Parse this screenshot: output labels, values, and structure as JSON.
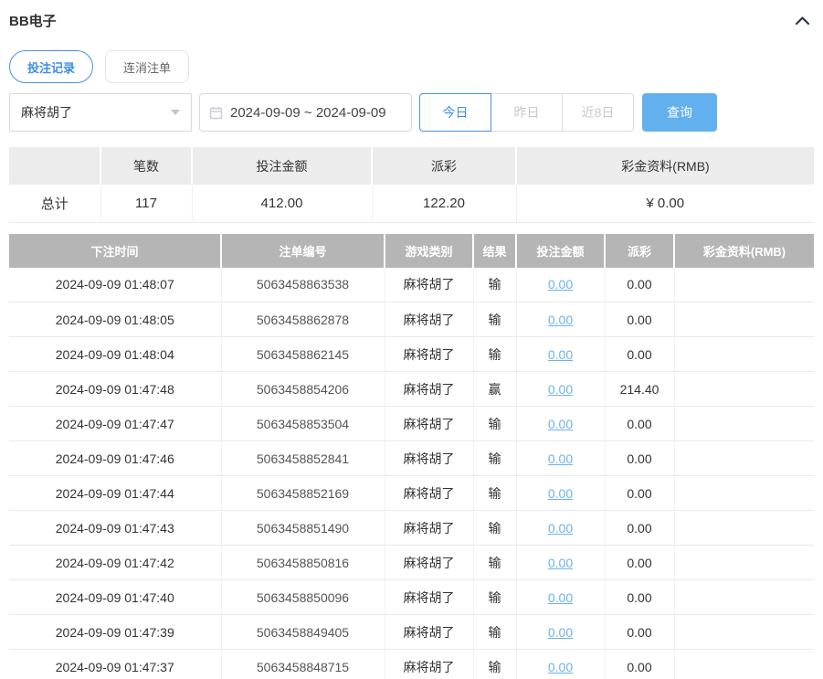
{
  "page": {
    "title": "BB电子"
  },
  "icons": {
    "collapse": "chevron-up-icon",
    "calendar": "calendar-icon",
    "select_caret": "caret-down-icon"
  },
  "colors": {
    "accent_blue": "#4a90e2",
    "query_button_bg": "#62b0ee",
    "link_blue": "#6cb3ea",
    "table_header_bg": "#b5b5b5",
    "summary_header_bg": "#ececec"
  },
  "tabs": [
    {
      "label": "投注记录",
      "active": true
    },
    {
      "label": "连消注单",
      "active": false
    }
  ],
  "filters": {
    "game_select": {
      "value": "麻将胡了"
    },
    "date_range": {
      "value": "2024-09-09 ~ 2024-09-09"
    },
    "quick_buttons": [
      {
        "label": "今日",
        "active": true
      },
      {
        "label": "昨日",
        "active": false
      },
      {
        "label": "近8日",
        "active": false
      }
    ],
    "query_label": "查询"
  },
  "summary": {
    "headers": [
      "",
      "笔数",
      "投注金额",
      "派彩",
      "彩金资料(RMB)"
    ],
    "row": {
      "label": "总计",
      "count": "117",
      "bet_amount": "412.00",
      "payout": "122.20",
      "bonus": "¥ 0.00"
    }
  },
  "records": {
    "headers": [
      "下注时间",
      "注单编号",
      "游戏类别",
      "结果",
      "投注金额",
      "派彩",
      "彩金资料(RMB)"
    ],
    "rows": [
      {
        "time": "2024-09-09 01:48:07",
        "order_id": "5063458863538",
        "game": "麻将胡了",
        "result": "输",
        "bet": "0.00",
        "payout": "0.00",
        "bonus": ""
      },
      {
        "time": "2024-09-09 01:48:05",
        "order_id": "5063458862878",
        "game": "麻将胡了",
        "result": "输",
        "bet": "0.00",
        "payout": "0.00",
        "bonus": ""
      },
      {
        "time": "2024-09-09 01:48:04",
        "order_id": "5063458862145",
        "game": "麻将胡了",
        "result": "输",
        "bet": "0.00",
        "payout": "0.00",
        "bonus": ""
      },
      {
        "time": "2024-09-09 01:47:48",
        "order_id": "5063458854206",
        "game": "麻将胡了",
        "result": "赢",
        "bet": "0.00",
        "payout": "214.40",
        "bonus": ""
      },
      {
        "time": "2024-09-09 01:47:47",
        "order_id": "5063458853504",
        "game": "麻将胡了",
        "result": "输",
        "bet": "0.00",
        "payout": "0.00",
        "bonus": ""
      },
      {
        "time": "2024-09-09 01:47:46",
        "order_id": "5063458852841",
        "game": "麻将胡了",
        "result": "输",
        "bet": "0.00",
        "payout": "0.00",
        "bonus": ""
      },
      {
        "time": "2024-09-09 01:47:44",
        "order_id": "5063458852169",
        "game": "麻将胡了",
        "result": "输",
        "bet": "0.00",
        "payout": "0.00",
        "bonus": ""
      },
      {
        "time": "2024-09-09 01:47:43",
        "order_id": "5063458851490",
        "game": "麻将胡了",
        "result": "输",
        "bet": "0.00",
        "payout": "0.00",
        "bonus": ""
      },
      {
        "time": "2024-09-09 01:47:42",
        "order_id": "5063458850816",
        "game": "麻将胡了",
        "result": "输",
        "bet": "0.00",
        "payout": "0.00",
        "bonus": ""
      },
      {
        "time": "2024-09-09 01:47:40",
        "order_id": "5063458850096",
        "game": "麻将胡了",
        "result": "输",
        "bet": "0.00",
        "payout": "0.00",
        "bonus": ""
      },
      {
        "time": "2024-09-09 01:47:39",
        "order_id": "5063458849405",
        "game": "麻将胡了",
        "result": "输",
        "bet": "0.00",
        "payout": "0.00",
        "bonus": ""
      },
      {
        "time": "2024-09-09 01:47:37",
        "order_id": "5063458848715",
        "game": "麻将胡了",
        "result": "输",
        "bet": "0.00",
        "payout": "0.00",
        "bonus": ""
      }
    ]
  }
}
